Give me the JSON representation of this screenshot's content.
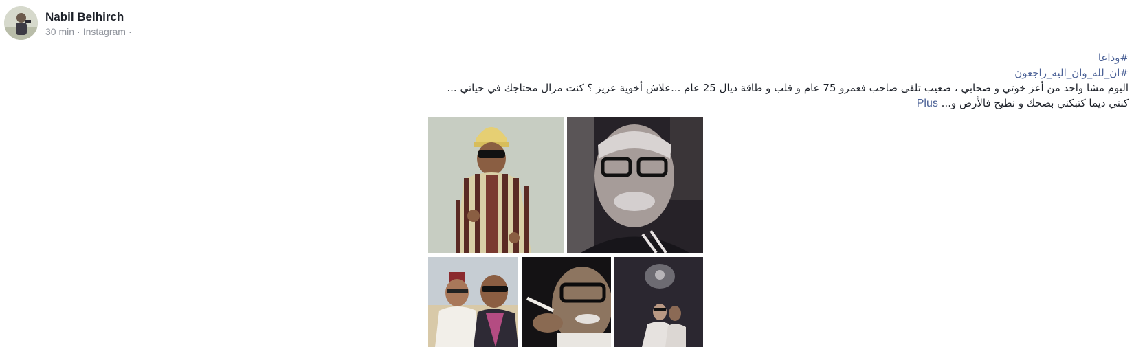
{
  "post": {
    "author": "Nabil Belhirch",
    "time": "30 min",
    "separator": "·",
    "source": "Instagram",
    "hashtags": [
      "#وداعا",
      "#ان_لله_وان_اليه_راجعون"
    ],
    "body_line1": "اليوم مشا واحد من أعز خوتي و صحابي ، صعيب تلقى صاحب فعمرو 75 عام و قلب و طاقة ديال 25 عام ...علاش أخوية عزيز ؟ كنت مزال محتاجك في حياتي ...",
    "body_line2": "كنتي ديما كتبكني بضحك و نطيح فالأرض و...",
    "more_label": "Plus"
  },
  "photos": [
    {
      "name": "photo-man-striped-djellaba-yellow-hat"
    },
    {
      "name": "photo-man-glasses-closeup-bw"
    },
    {
      "name": "photo-two-men-fez-sunglasses"
    },
    {
      "name": "photo-man-smoking-cigarette"
    },
    {
      "name": "photo-two-men-dark-background"
    }
  ],
  "colors": {
    "link": "#4b6196",
    "meta": "#90949c",
    "name": "#1d2129"
  }
}
